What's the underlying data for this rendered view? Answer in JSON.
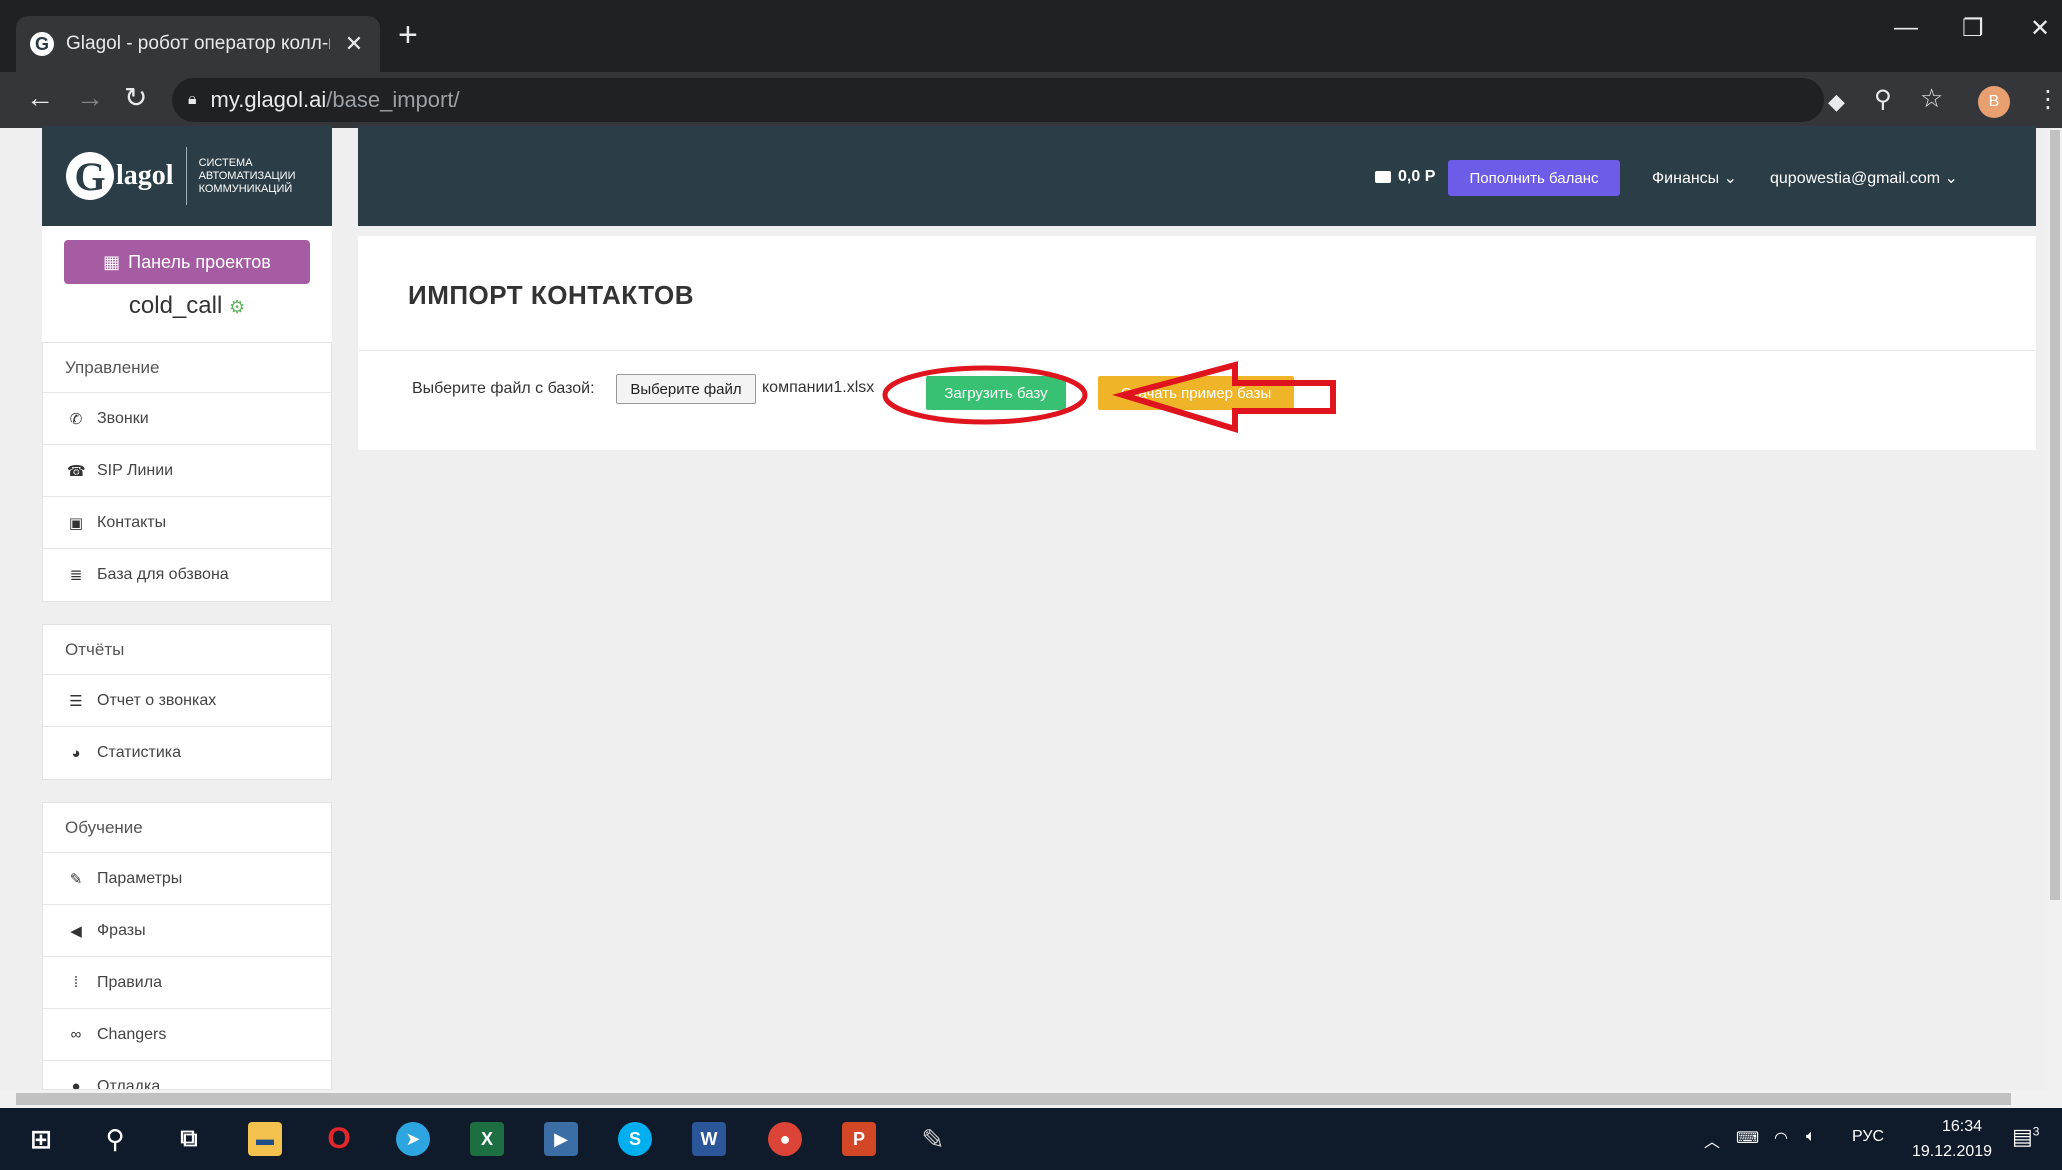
{
  "browser": {
    "tab_title": "Glagol - робот оператор колл-ц",
    "tab_favicon": "G",
    "url_host": "my.glagol.ai",
    "url_path": "/base_import/",
    "profile_initial": "B"
  },
  "logo": {
    "letter": "G",
    "word": "lagol",
    "tagline": [
      "СИСТЕМА",
      "АВТОМАТИЗАЦИИ",
      "КОММУНИКАЦИЙ"
    ]
  },
  "project": {
    "panel_button": "Панель проектов",
    "name": "cold_call"
  },
  "sidebar": {
    "management": {
      "header": "Управление",
      "items": [
        {
          "label": "Звонки",
          "icon": "phone-icon",
          "glyph": "✆"
        },
        {
          "label": "SIP Линии",
          "icon": "sip-phone-icon",
          "glyph": "☎"
        },
        {
          "label": "Контакты",
          "icon": "contacts-icon",
          "glyph": "▣"
        },
        {
          "label": "База для обзвона",
          "icon": "database-icon",
          "glyph": "≣"
        }
      ]
    },
    "reports": {
      "header": "Отчёты",
      "items": [
        {
          "label": "Отчет о звонках",
          "icon": "list-icon",
          "glyph": "☰"
        },
        {
          "label": "Статистика",
          "icon": "pie-chart-icon",
          "glyph": "◕"
        }
      ]
    },
    "training": {
      "header": "Обучение",
      "items": [
        {
          "label": "Параметры",
          "icon": "settings-icon",
          "glyph": "✎"
        },
        {
          "label": "Фразы",
          "icon": "megaphone-icon",
          "glyph": "◀"
        },
        {
          "label": "Правила",
          "icon": "rules-icon",
          "glyph": "⁞"
        },
        {
          "label": "Changers",
          "icon": "changers-icon",
          "glyph": "∞"
        },
        {
          "label": "Отладка",
          "icon": "debug-icon",
          "glyph": "●"
        }
      ]
    }
  },
  "header": {
    "balance": "0,0 Р",
    "topup_label": "Пополнить баланс",
    "finance_label": "Финансы ⌄",
    "user_email": "qupowestia@gmail.com ⌄"
  },
  "import": {
    "title": "ИМПОРТ КОНТАКТОВ",
    "file_label": "Выберите файл с базой:",
    "file_button": "Выберите файл",
    "file_name": "компании1.xlsx",
    "upload_button": "Загрузить базу",
    "sample_button": "Скачать пример базы"
  },
  "annotation": {
    "highlight_color": "#e0141e"
  },
  "taskbar": {
    "language": "РУС",
    "time": "16:34",
    "date": "19.12.2019",
    "notifications": "3"
  },
  "colors": {
    "header_bg": "#2b3e48",
    "accent_purple": "#a55ca3",
    "topup": "#6c5ce7",
    "upload_green": "#38c172",
    "sample_orange": "#f0b429"
  }
}
